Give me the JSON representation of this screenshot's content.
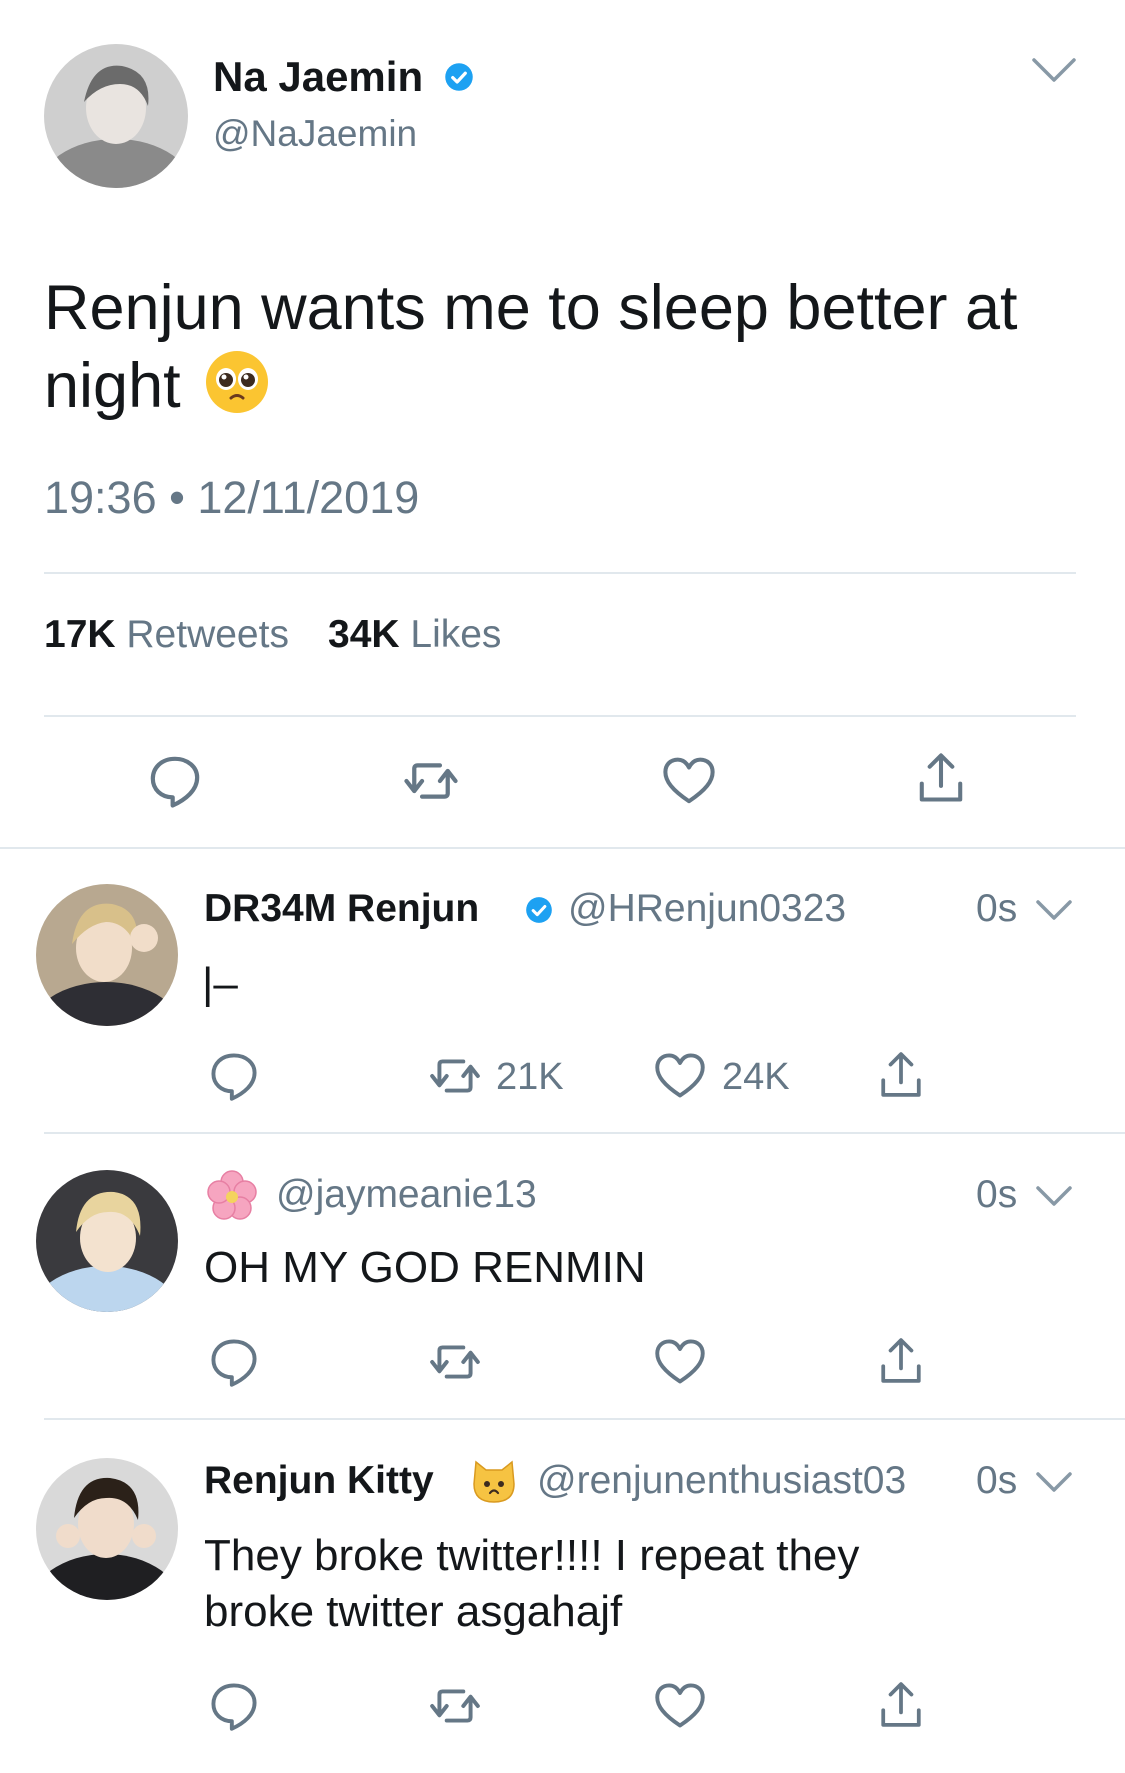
{
  "main_tweet": {
    "name": "Na Jaemin",
    "handle": "@NaJaemin",
    "text_line1": "Renjun wants me to sleep better at",
    "text_line2": "night",
    "emoji": "pleading-face-emoji",
    "timestamp": "19:36 • 12/11/2019",
    "retweets_count": "17K",
    "retweets_label": "Retweets",
    "likes_count": "34K",
    "likes_label": "Likes"
  },
  "replies": [
    {
      "name": "DR34M Renjun",
      "handle": "@HRenjun0323",
      "time": "0s",
      "text": "|–",
      "retweets": "21K",
      "likes": "24K",
      "verified": true
    },
    {
      "name": "",
      "name_emoji": "cherry-blossom-emoji",
      "handle": "@jaymeanie13",
      "time": "0s",
      "text": "OH MY GOD RENMIN",
      "retweets": "",
      "likes": ""
    },
    {
      "name": "Renjun Kitty",
      "name_emoji": "cat-face-emoji",
      "handle": "@renjunenthusiast03",
      "time": "0s",
      "text_line1": "They broke twitter!!!! I repeat they",
      "text_line2": "broke twitter asgahajf",
      "retweets": "",
      "likes": ""
    }
  ],
  "colors": {
    "verified_blue": "#1da1f2",
    "secondary_text": "#657786",
    "divider": "#e1e8ed",
    "icon_gray": "#657786"
  }
}
